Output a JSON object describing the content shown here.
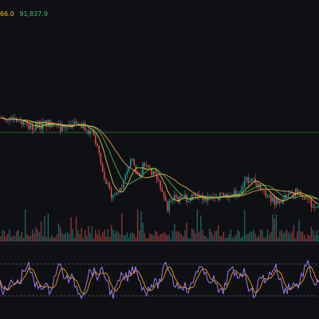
{
  "header": {
    "ma_values": [
      {
        "label": "66.0",
        "color": "#f0c419"
      },
      {
        "label": "91,837.9",
        "color": "#47c26b"
      }
    ]
  },
  "colors": {
    "background": "#0f1014",
    "up_candle": "#26a69a",
    "down_candle": "#ef5350",
    "ma_fast": "#d9c14a",
    "ma_mid": "#4caf50",
    "ma_slow": "#e0a34a",
    "reference_line": "#2f7d3c",
    "oscillator_fast": "#a78bfa",
    "oscillator_slow": "#f59e0b",
    "oscillator_band": "#5b5f6a",
    "pane_divider": "#23252b"
  },
  "icons": [
    "none"
  ]
}
